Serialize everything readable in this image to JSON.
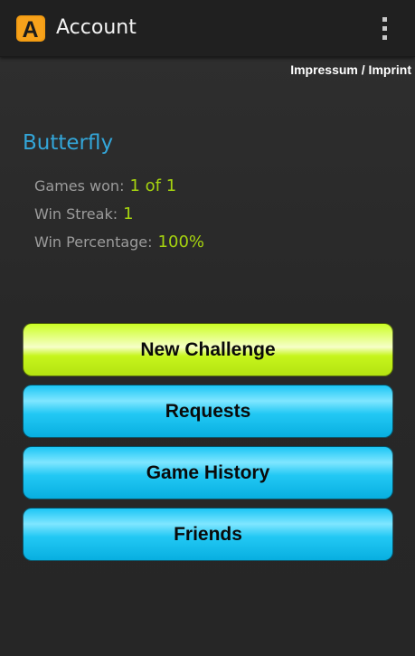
{
  "action_bar": {
    "title": "Account",
    "logo_letter": "A",
    "logo_color": "#f39c12",
    "menu_icon": "overflow-menu-icon"
  },
  "imprint_link": "Impressum / Imprint",
  "profile": {
    "name": "Butterfly",
    "stats": [
      {
        "label": "Games won:",
        "value": "1 of 1"
      },
      {
        "label": "Win Streak:",
        "value": "1"
      },
      {
        "label": "Win Percentage:",
        "value": "100%"
      }
    ]
  },
  "buttons": {
    "new_challenge": "New Challenge",
    "requests": "Requests",
    "game_history": "Game History",
    "friends": "Friends"
  },
  "colors": {
    "accent_blue": "#33a6d9",
    "stat_green": "#a6d40f",
    "button_green": "#ccff24",
    "button_blue": "#1bc6f5"
  }
}
